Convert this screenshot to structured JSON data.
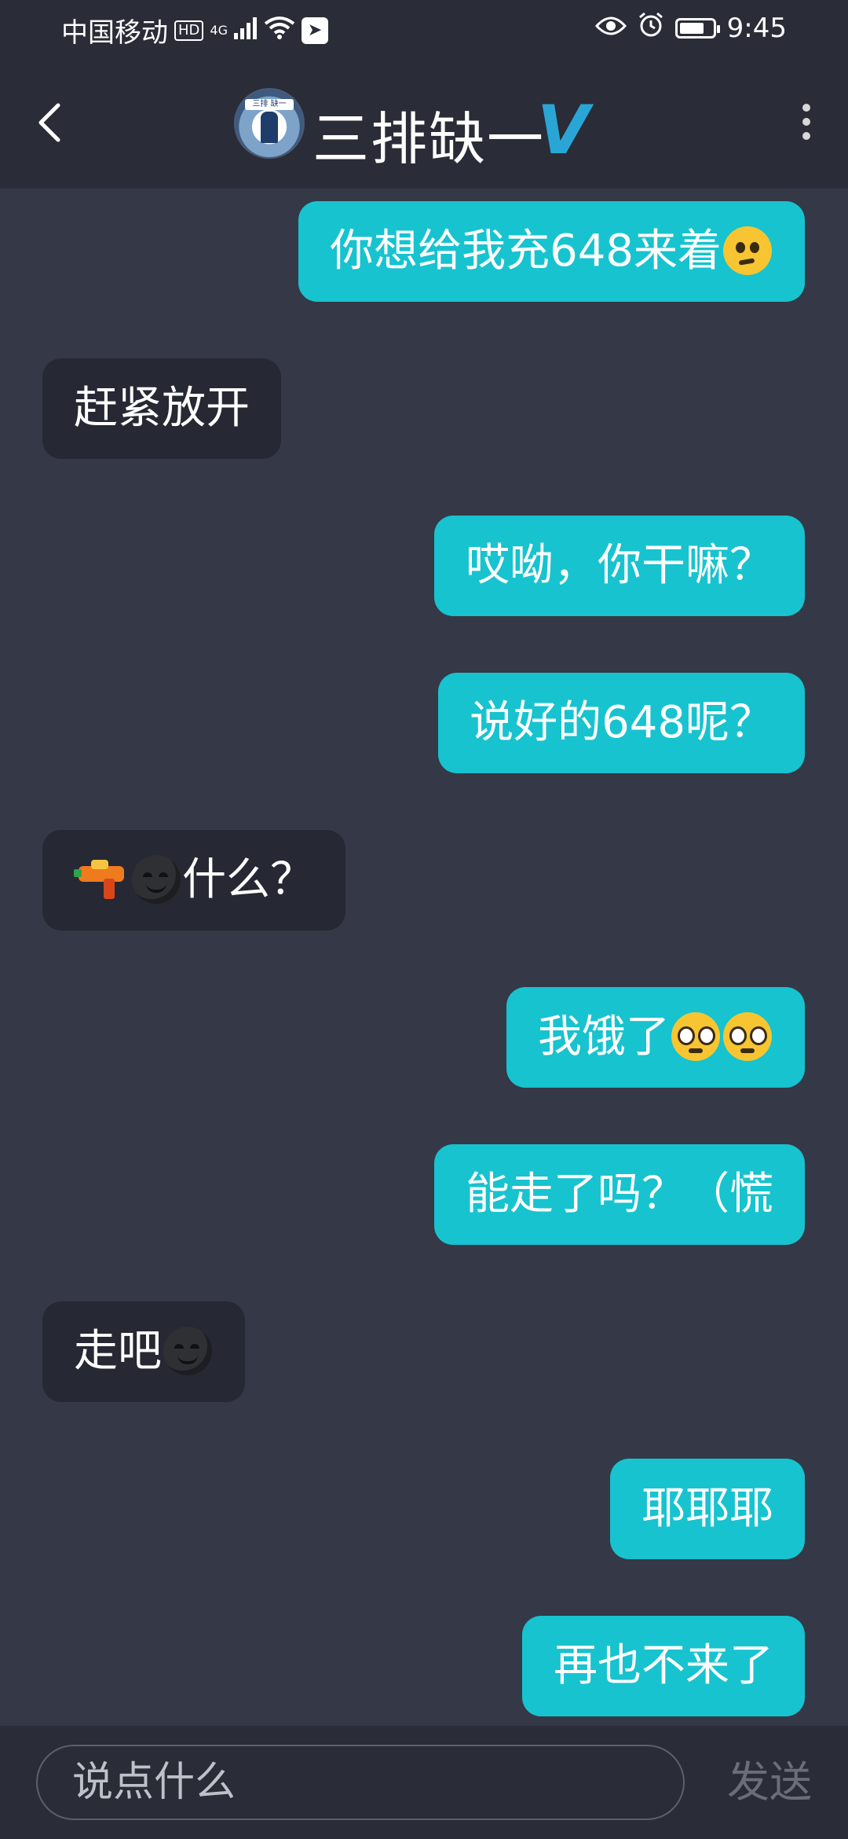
{
  "status_bar": {
    "carrier": "中国移动",
    "hd": "HD",
    "network": "4G",
    "time": "9:45"
  },
  "header": {
    "back_icon": "chevron-left-icon",
    "avatar_text": "三排 缺一",
    "title": "三排缺一",
    "badge": "V",
    "menu_icon": "more-vertical-icon"
  },
  "messages": [
    {
      "side": "out",
      "text": "你想给我充648来着"
    },
    {
      "side": "in",
      "text": "赶紧放开"
    },
    {
      "side": "out",
      "text": "哎呦，你干嘛？"
    },
    {
      "side": "out",
      "text": "说好的648呢？"
    },
    {
      "side": "in",
      "text": "什么？"
    },
    {
      "side": "out",
      "text": "我饿了"
    },
    {
      "side": "out",
      "text": "能走了吗？（慌"
    },
    {
      "side": "in",
      "text": "走吧"
    },
    {
      "side": "out",
      "text": "耶耶耶"
    },
    {
      "side": "out",
      "text": "再也不来了"
    }
  ],
  "input": {
    "placeholder": "说点什么",
    "send_label": "发送"
  },
  "colors": {
    "background": "#353846",
    "bar": "#2a2c37",
    "outgoing_bubble": "#17c3cf",
    "incoming_bubble": "#262833",
    "verified_badge": "#29a6d6"
  }
}
